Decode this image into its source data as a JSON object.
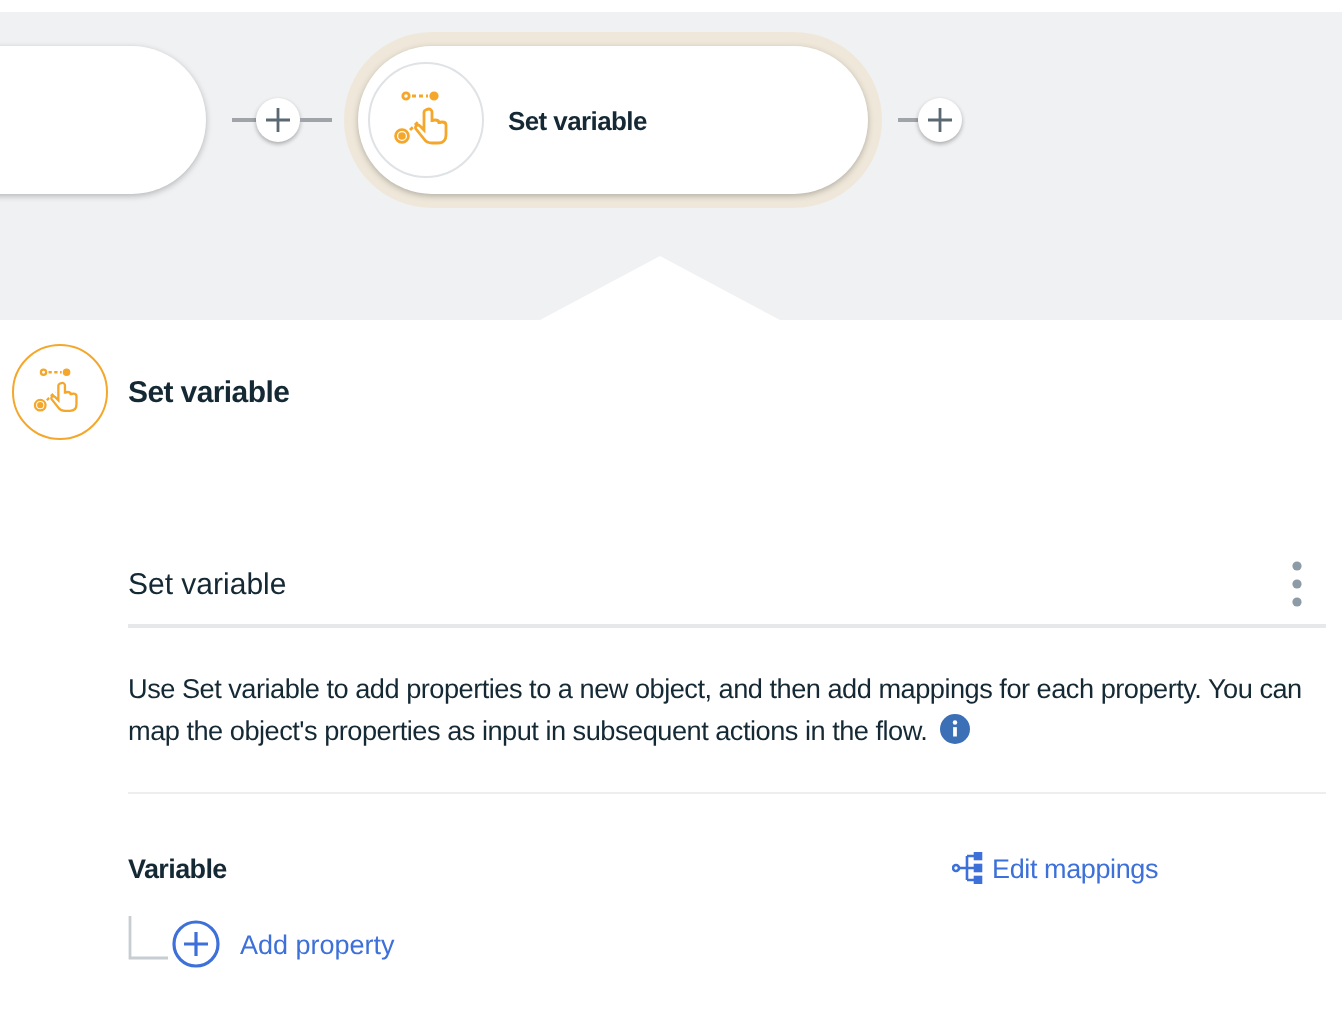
{
  "flow": {
    "nodes": [
      {
        "kind": "cut",
        "selected": false
      },
      {
        "kind": "action",
        "label": "Set variable",
        "selected": true
      }
    ]
  },
  "panel": {
    "title": "Set variable",
    "name_field": {
      "value": "Set variable"
    },
    "description": "Use Set variable to add properties to a new object, and then add mappings for each property. You can map the object's properties as input in subsequent actions in the flow.",
    "section_label": "Variable",
    "edit_mappings": "Edit mappings",
    "add_property": "Add property"
  }
}
